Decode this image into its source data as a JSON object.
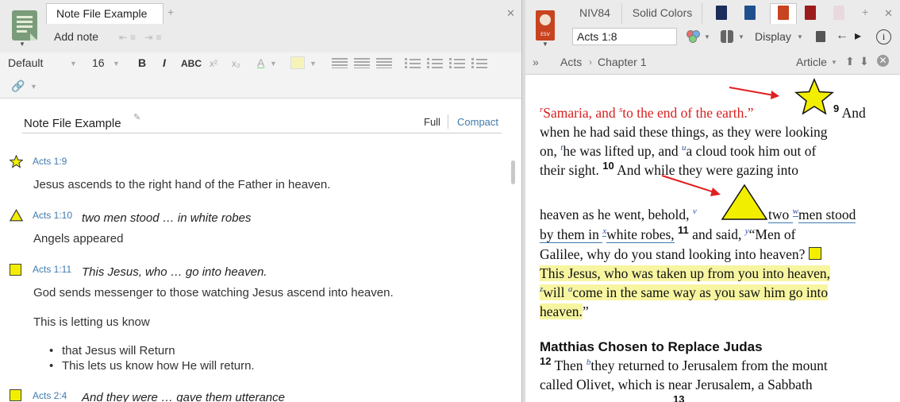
{
  "notes_panel": {
    "tab_label": "Note File Example",
    "add_note_label": "Add note",
    "format": {
      "style": "Default",
      "size": "16",
      "bold": "B",
      "italic": "I",
      "smallcaps": "ABC",
      "superscript": "x²",
      "subscript": "x₂",
      "font_color": "A"
    },
    "title": "Note File Example",
    "view_full": "Full",
    "view_compact": "Compact",
    "notes": [
      {
        "icon": "star-icon",
        "ref": "Acts 1:9",
        "quote": "",
        "body": "Jesus ascends to the right hand of the Father in heaven."
      },
      {
        "icon": "triangle-icon",
        "ref": "Acts 1:10",
        "quote": "two men stood … in white robes",
        "body": "Angels appeared"
      },
      {
        "icon": "square-icon",
        "ref": "Acts 1:11",
        "quote": "This Jesus, who … go into heaven.",
        "body": "God sends messenger to those watching Jesus ascend into heaven.",
        "body2": "This is letting us know",
        "bullets": [
          "that Jesus will Return",
          "This lets us know how He will return."
        ]
      },
      {
        "icon": "square-icon",
        "ref": "Acts 2:4",
        "quote": "And they were … gave them utterance"
      }
    ]
  },
  "bible_panel": {
    "tabs": [
      "NIV84",
      "Solid Colors"
    ],
    "book_label": "ESV",
    "reference": "Acts 1:8",
    "display_label": "Display",
    "breadcrumb": [
      "Acts",
      "Chapter 1"
    ],
    "article_label": "Article",
    "text": {
      "l1a": "Samaria, and ",
      "l1b": "to the end of the earth.”",
      "v9": "9",
      "l1c": " And",
      "l2": "when he had said these things, as they were looking",
      "l3a": "on, ",
      "l3b": "he was lifted up, and ",
      "l3c": "a cloud took him out of",
      "l4a": "their sight. ",
      "v10": "10",
      "l4b": " And while they were gazing into",
      "l5a": "heaven as he went, behold, ",
      "l5b": "two ",
      "l5c": "men stood",
      "l6a": "by them in ",
      "l6b": "white robes,",
      "v11": "11",
      "l6c": " and said, ",
      "l6d": "“Men of",
      "l7": "Galilee, why do you stand looking into heaven?",
      "l8": "This Jesus, who was taken up from you into heaven,",
      "l9a": "will ",
      "l9b": "come in the same way as you saw him go into",
      "l10": "heaven.",
      "l10b": "”",
      "heading": "Matthias Chosen to Replace Judas",
      "v12": "12",
      "l11a": " Then ",
      "l11b": "they returned to Jerusalem from the mount",
      "l12": "called Olivet, which is near Jerusalem, a Sabbath",
      "v13": "13",
      "fn": {
        "r": "r",
        "s": "s",
        "t": "t",
        "u": "u",
        "v": "v",
        "w": "w",
        "x": "x",
        "y": "y",
        "z": "z",
        "a": "a",
        "b": "b"
      }
    }
  },
  "colors": {
    "highlight": "#f7f5a0",
    "red_letter": "#d81f1f",
    "link_blue": "#3f7aaf",
    "shape_yellow": "#f2ee00",
    "arrow_red": "#e02020"
  }
}
